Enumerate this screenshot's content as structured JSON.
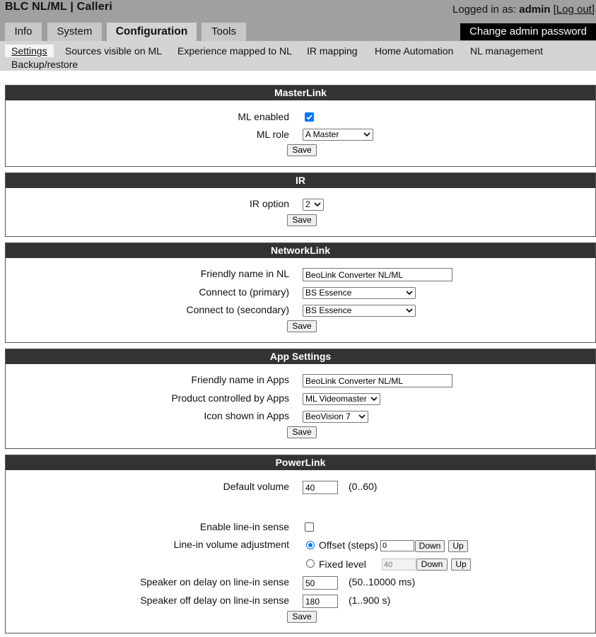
{
  "header": {
    "title": "BLC NL/ML | Calleri",
    "logged_in_prefix": "Logged in as: ",
    "username": "admin",
    "logout_open": "[",
    "logout_label": "Log out",
    "logout_close": "]",
    "change_password_label": "Change admin password"
  },
  "main_tabs": [
    {
      "label": "Info"
    },
    {
      "label": "System"
    },
    {
      "label": "Configuration",
      "active": true
    },
    {
      "label": "Tools"
    }
  ],
  "subnav": [
    {
      "label": "Settings",
      "active": true
    },
    {
      "label": "Sources visible on ML"
    },
    {
      "label": "Experience mapped to NL"
    },
    {
      "label": "IR mapping"
    },
    {
      "label": "Home Automation"
    },
    {
      "label": "NL management"
    },
    {
      "label": "Backup/restore"
    }
  ],
  "save_label": "Save",
  "masterlink": {
    "title": "MasterLink",
    "enabled_label": "ML enabled",
    "enabled": true,
    "role_label": "ML role",
    "role_value": "A Master"
  },
  "ir": {
    "title": "IR",
    "option_label": "IR option",
    "option_value": "2"
  },
  "networklink": {
    "title": "NetworkLink",
    "friendly_label": "Friendly name in NL",
    "friendly_value": "BeoLink Converter NL/ML",
    "primary_label": "Connect to (primary)",
    "primary_value": "BS Essence",
    "secondary_label": "Connect to (secondary)",
    "secondary_value": "BS Essence"
  },
  "apps": {
    "title": "App Settings",
    "friendly_label": "Friendly name in Apps",
    "friendly_value": "BeoLink Converter NL/ML",
    "product_label": "Product controlled by Apps",
    "product_value": "ML Videomaster",
    "icon_label": "Icon shown in Apps",
    "icon_value": "BeoVision 7"
  },
  "powerlink": {
    "title": "PowerLink",
    "default_volume_label": "Default volume",
    "default_volume_value": "40",
    "default_volume_range": "(0..60)",
    "line_in_sense_label": "Enable line-in sense",
    "line_in_sense": false,
    "adjust_label": "Line-in volume adjustment",
    "offset_label": "Offset (steps)",
    "offset_value": "0",
    "offset_selected": true,
    "fixed_label": "Fixed level",
    "fixed_value": "40",
    "down_label": "Down",
    "up_label": "Up",
    "on_delay_label": "Speaker on delay on line-in sense",
    "on_delay_value": "50",
    "on_delay_range": "(50..10000 ms)",
    "off_delay_label": "Speaker off delay on line-in sense",
    "off_delay_value": "180",
    "off_delay_range": "(1..900 s)"
  },
  "colors": {
    "header_bg": "#a0a0a0",
    "section_head_bg": "#333333",
    "accent_blue": "#0075ff"
  }
}
